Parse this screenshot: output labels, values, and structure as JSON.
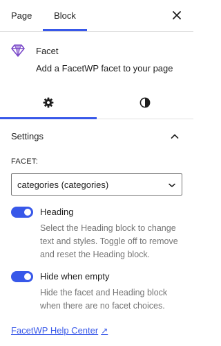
{
  "tabs": [
    {
      "label": "Page"
    },
    {
      "label": "Block",
      "active": true
    }
  ],
  "header": {
    "close_icon": "close-icon"
  },
  "block": {
    "icon": "facet-icon",
    "title": "Facet",
    "description": "Add a FacetWP facet to your page"
  },
  "subtabs": [
    {
      "icon": "gear-icon",
      "active": true
    },
    {
      "icon": "contrast-icon",
      "active": false
    }
  ],
  "panel": {
    "title": "Settings",
    "expanded": true,
    "facet": {
      "label": "FACET:",
      "selected": "categories (categories)"
    },
    "heading_toggle": {
      "label": "Heading",
      "on": true,
      "help": "Select the Heading block to change text and styles. Toggle off to remove and reset the Heading block."
    },
    "hide_empty_toggle": {
      "label": "Hide when empty",
      "on": true,
      "help": "Hide the facet and Heading block when there are no facet choices."
    },
    "help_link": {
      "label": "FacetWP Help Center",
      "icon": "external-link-icon"
    }
  },
  "colors": {
    "accent": "#3858e9",
    "text": "#1e1e1e",
    "muted": "#757575",
    "border": "#e0e0e0",
    "facet_icon": "#7b4ac9"
  }
}
